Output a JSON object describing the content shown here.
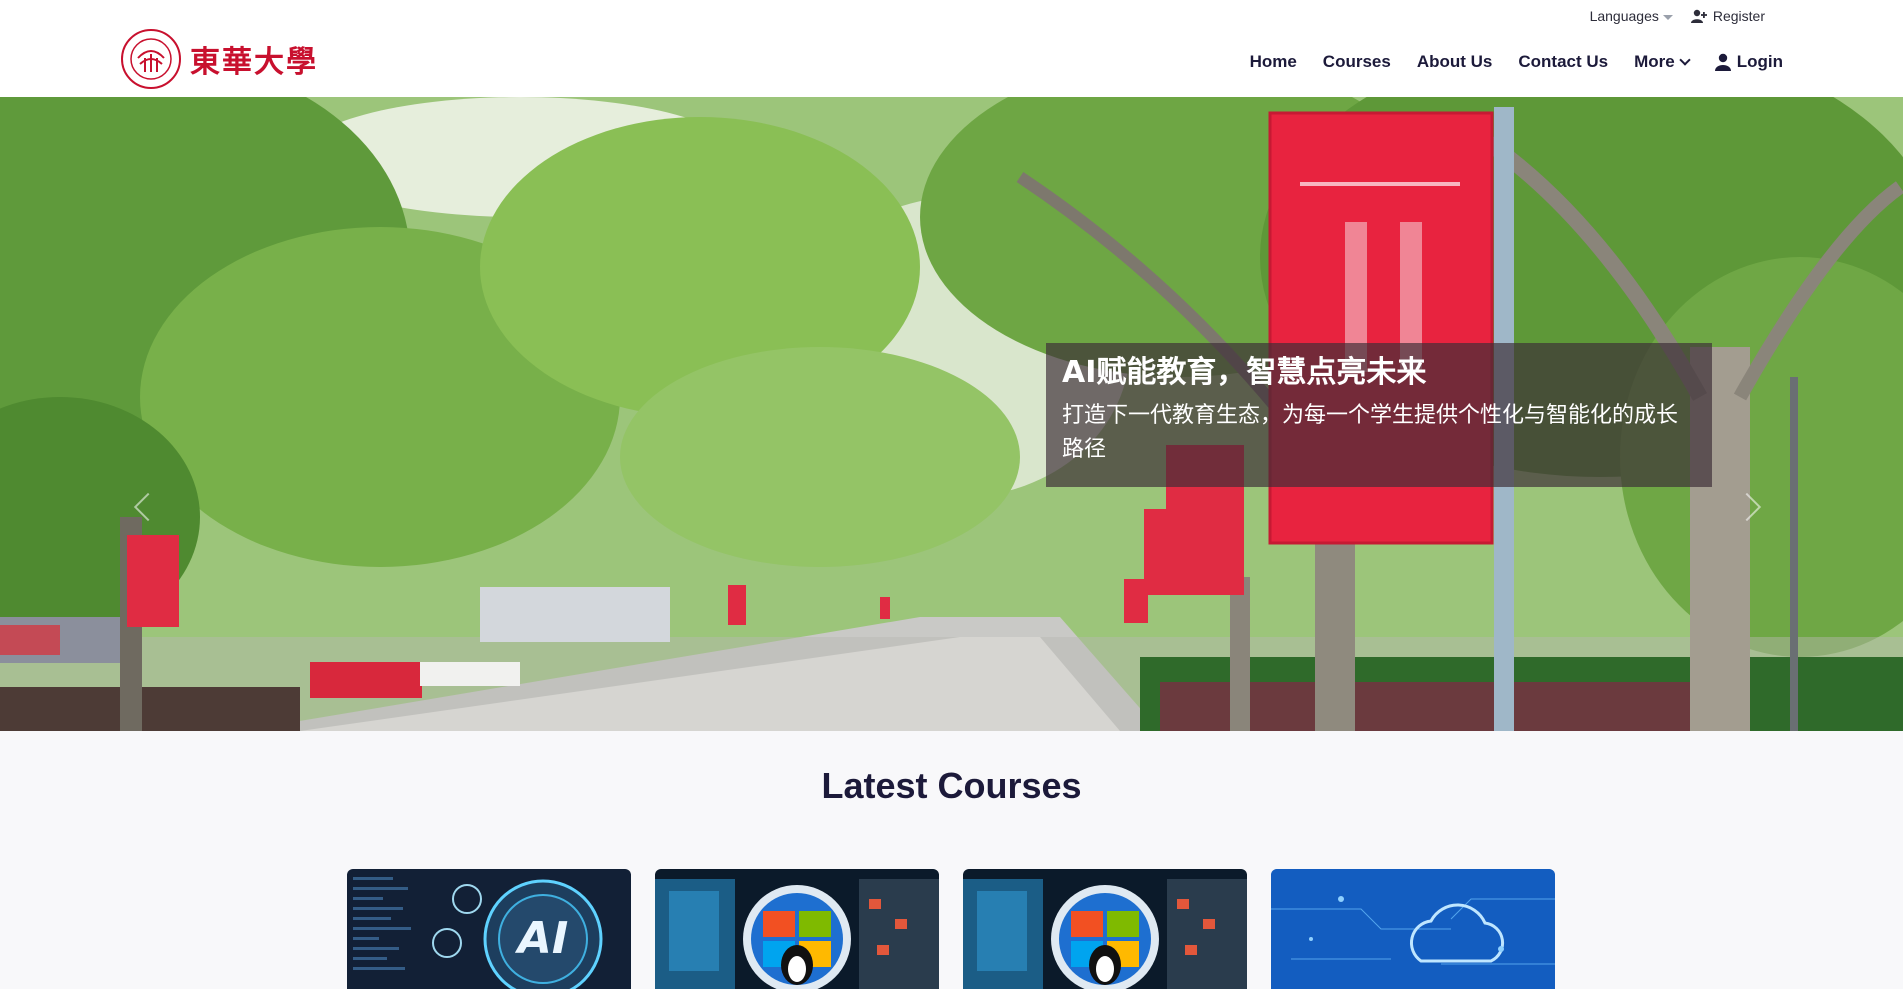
{
  "header": {
    "logo_text": "東華大學",
    "languages_label": "Languages",
    "register_label": "Register",
    "nav": [
      {
        "label": "Home"
      },
      {
        "label": "Courses"
      },
      {
        "label": "About Us"
      },
      {
        "label": "Contact Us"
      },
      {
        "label": "More"
      },
      {
        "label": "Login"
      }
    ]
  },
  "hero": {
    "title": "AI赋能教育，智慧点亮未来",
    "subtitle": "打造下一代教育生态，为每一个学生提供个性化与智能化的成长路径"
  },
  "courses": {
    "title": "Latest Courses",
    "cards": [
      {
        "image": "ai-brain-chip",
        "overlay_text": "AI"
      },
      {
        "image": "windows-linux-monitors"
      },
      {
        "image": "windows-linux-monitors"
      },
      {
        "image": "cloud-network"
      }
    ]
  },
  "colors": {
    "brand": "#c8102e",
    "nav_text": "#1c1a3a",
    "banner_red": "#e8233f"
  }
}
